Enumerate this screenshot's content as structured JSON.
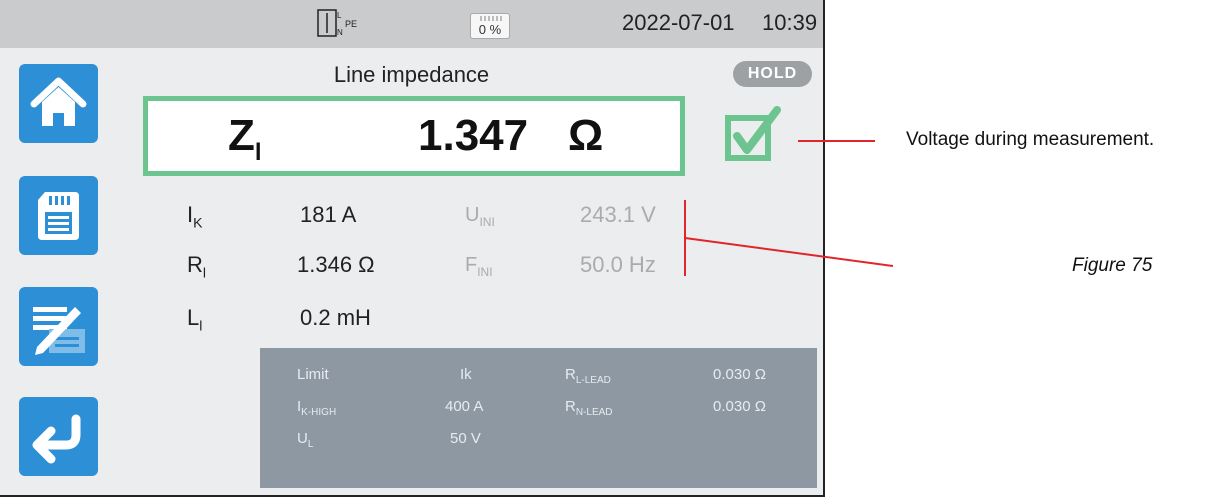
{
  "status_bar": {
    "connection_icon": "L-N-PE-connection-icon",
    "battery": {
      "percent_label": "0 %",
      "icon": "battery-icon"
    },
    "date": "2022-07-01",
    "time": "10:39"
  },
  "sidebar": {
    "buttons": [
      {
        "name": "home",
        "icon": "home-icon"
      },
      {
        "name": "save",
        "icon": "sd-card-icon"
      },
      {
        "name": "edit",
        "icon": "edit-note-icon"
      },
      {
        "name": "back",
        "icon": "return-arrow-icon"
      }
    ]
  },
  "measurement": {
    "title": "Line impedance",
    "hold_label": "HOLD",
    "main": {
      "symbol": "Z",
      "symbol_sub": "l",
      "value": "1.347",
      "unit": "Ω"
    },
    "status_icon": "checkmark-ok-icon",
    "results": [
      {
        "symbol": "I",
        "sub": "K",
        "value": "181 A"
      },
      {
        "symbol": "R",
        "sub": "l",
        "value": "1.346 Ω"
      },
      {
        "symbol": "L",
        "sub": "l",
        "value": "0.2 mH"
      }
    ],
    "voltage_results": [
      {
        "symbol": "U",
        "sub": "INI",
        "value": "243.1 V"
      },
      {
        "symbol": "F",
        "sub": "INI",
        "value": "50.0 Hz"
      }
    ]
  },
  "limits": {
    "row1": {
      "label": "Limit",
      "value": "Ik",
      "label2_main": "R",
      "label2_sub": "L-LEAD",
      "value2": "0.030 Ω"
    },
    "row2": {
      "label_main": "I",
      "label_sub": "K-HIGH",
      "value": "400 A",
      "label2_main": "R",
      "label2_sub": "N-LEAD",
      "value2": "0.030 Ω"
    },
    "row3": {
      "label_main": "U",
      "label_sub": "L",
      "value": "50 V"
    }
  },
  "annotations": {
    "callout": "Voltage during measurement.",
    "figure": "Figure 75"
  },
  "colors": {
    "accent_blue": "#2d8fd6",
    "ok_green": "#6cc48f",
    "callout_red": "#e0252b",
    "limits_panel": "#8d98a3"
  }
}
